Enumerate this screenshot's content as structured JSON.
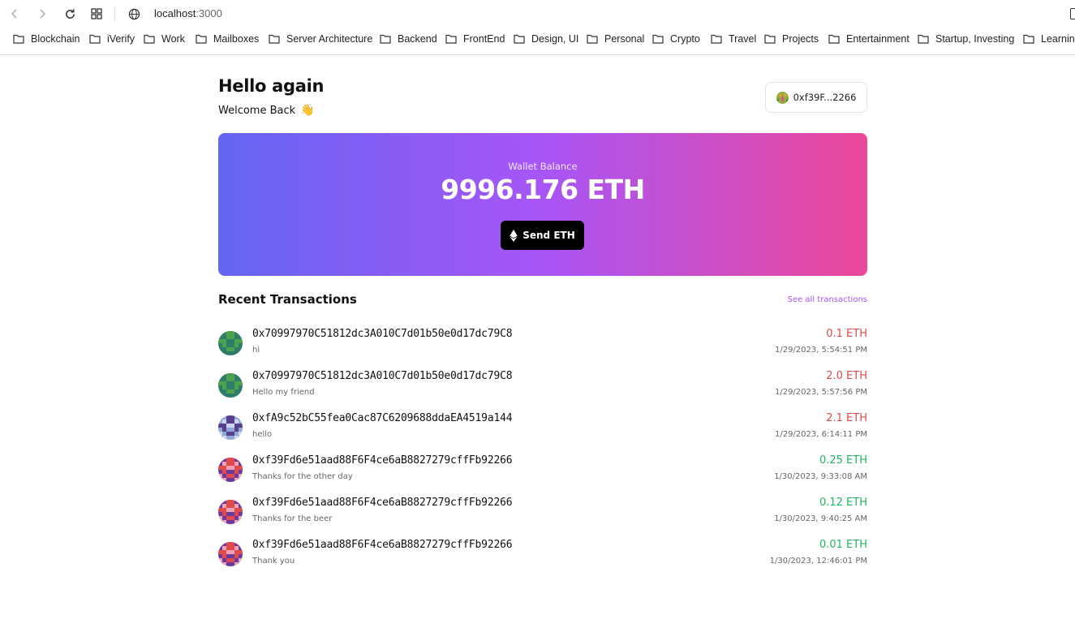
{
  "browser": {
    "url_host": "localhost",
    "url_port": ":3000",
    "bookmarks": [
      "Blockchain",
      "iVerify",
      "Work",
      "Mailboxes",
      "Server Architecture",
      "Backend",
      "FrontEnd",
      "Design, UI",
      "Personal",
      "Crypto",
      "Travel",
      "Projects",
      "Entertainment",
      "Startup, Investing",
      "Learning"
    ]
  },
  "header": {
    "title": "Hello again",
    "subtitle": "Welcome Back",
    "wave_emoji": "👋",
    "account_short": "0xf39F...2266"
  },
  "balance": {
    "label": "Wallet Balance",
    "value": "9996.176 ETH",
    "send_label": "Send ETH"
  },
  "transactions": {
    "title": "Recent Transactions",
    "see_all": "See all transactions",
    "items": [
      {
        "address": "0x70997970C51812dc3A010C7d01b50e0d17dc79C8",
        "message": "hi",
        "amount": "0.1 ETH",
        "direction": "out",
        "date": "1/29/2023, 5:54:51 PM"
      },
      {
        "address": "0x70997970C51812dc3A010C7d01b50e0d17dc79C8",
        "message": "Hello my friend",
        "amount": "2.0 ETH",
        "direction": "out",
        "date": "1/29/2023, 5:57:56 PM"
      },
      {
        "address": "0xfA9c52bC55fea0Cac87C6209688ddaEA4519a144",
        "message": "hello",
        "amount": "2.1 ETH",
        "direction": "out",
        "date": "1/29/2023, 6:14:11 PM"
      },
      {
        "address": "0xf39Fd6e51aad88F6F4ce6aB8827279cffFb92266",
        "message": "Thanks for the other day",
        "amount": "0.25 ETH",
        "direction": "in",
        "date": "1/30/2023, 9:33:08 AM"
      },
      {
        "address": "0xf39Fd6e51aad88F6F4ce6aB8827279cffFb92266",
        "message": "Thanks for the beer",
        "amount": "0.12 ETH",
        "direction": "in",
        "date": "1/30/2023, 9:40:25 AM"
      },
      {
        "address": "0xf39Fd6e51aad88F6F4ce6aB8827279cffFb92266",
        "message": "Thank you",
        "amount": "0.01 ETH",
        "direction": "in",
        "date": "1/30/2023, 12:46:01 PM"
      }
    ]
  },
  "colors": {
    "gradient_start": "#6366f1",
    "gradient_mid": "#a855f7",
    "gradient_end": "#ec4899",
    "sent_amount": "#dc4b4b",
    "received_amount": "#22b55e",
    "link": "#a855f7"
  }
}
